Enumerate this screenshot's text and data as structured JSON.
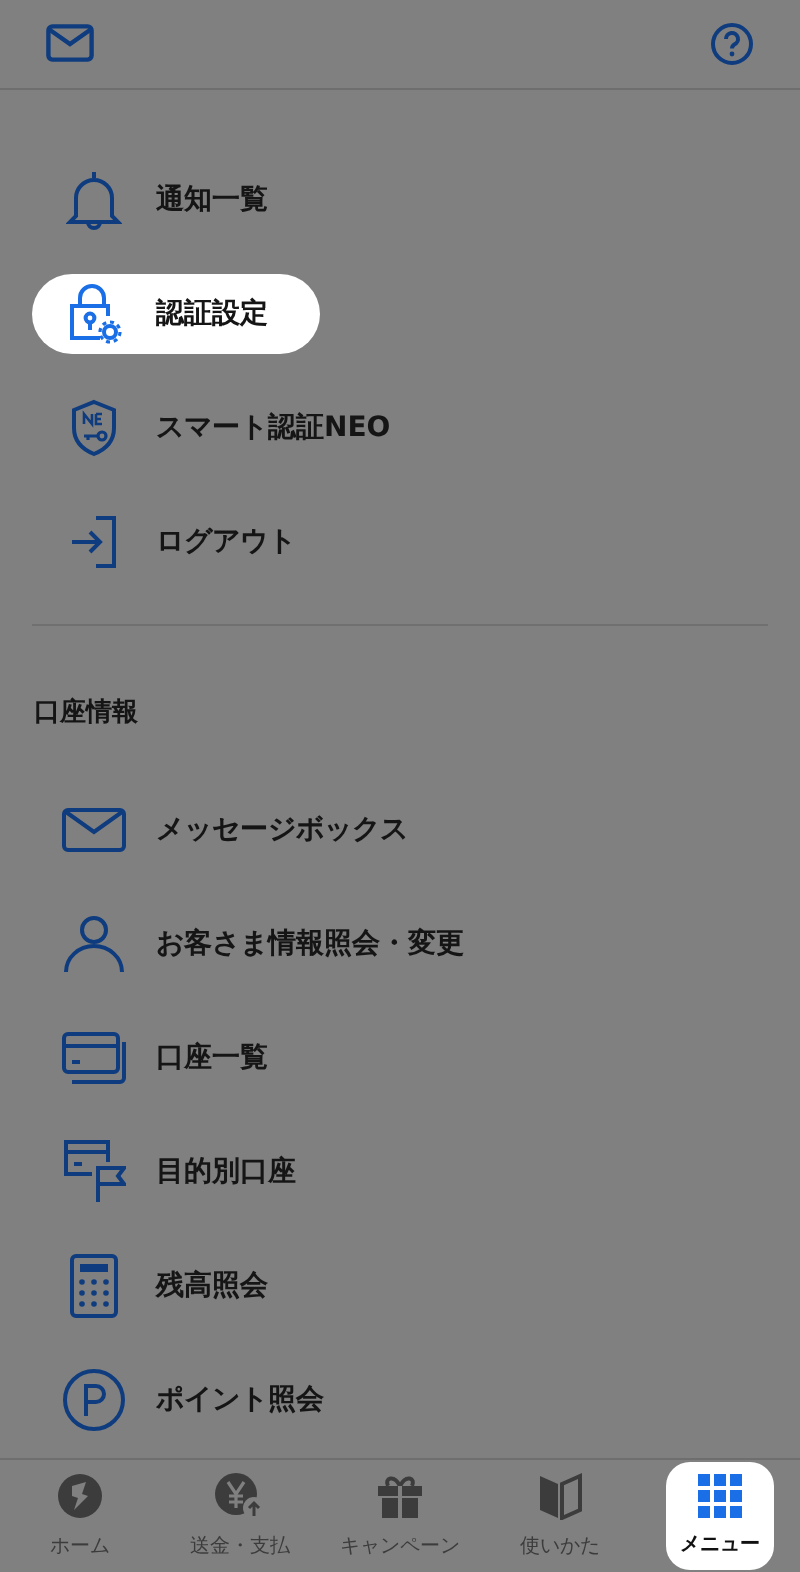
{
  "menu": [
    {
      "label": "通知一覧",
      "highlighted": false
    },
    {
      "label": "認証設定",
      "highlighted": true
    },
    {
      "label": "スマート認証NEO",
      "highlighted": false
    },
    {
      "label": "ログアウト",
      "highlighted": false
    }
  ],
  "account_section": {
    "title": "口座情報",
    "items": [
      {
        "label": "メッセージボックス",
        "highlighted": false
      },
      {
        "label": "お客さま情報照会・変更",
        "highlighted": false
      },
      {
        "label": "口座一覧",
        "highlighted": false
      },
      {
        "label": "目的別口座",
        "highlighted": false
      },
      {
        "label": "残高照会",
        "highlighted": false
      },
      {
        "label": "ポイント照会",
        "highlighted": false
      }
    ]
  },
  "tab_bar": [
    {
      "label": "ホーム",
      "selected": false
    },
    {
      "label": "送金・支払",
      "selected": false
    },
    {
      "label": "キャンペーン",
      "selected": false
    },
    {
      "label": "使いかた",
      "selected": false
    },
    {
      "label": "メニュー",
      "selected": true
    }
  ]
}
